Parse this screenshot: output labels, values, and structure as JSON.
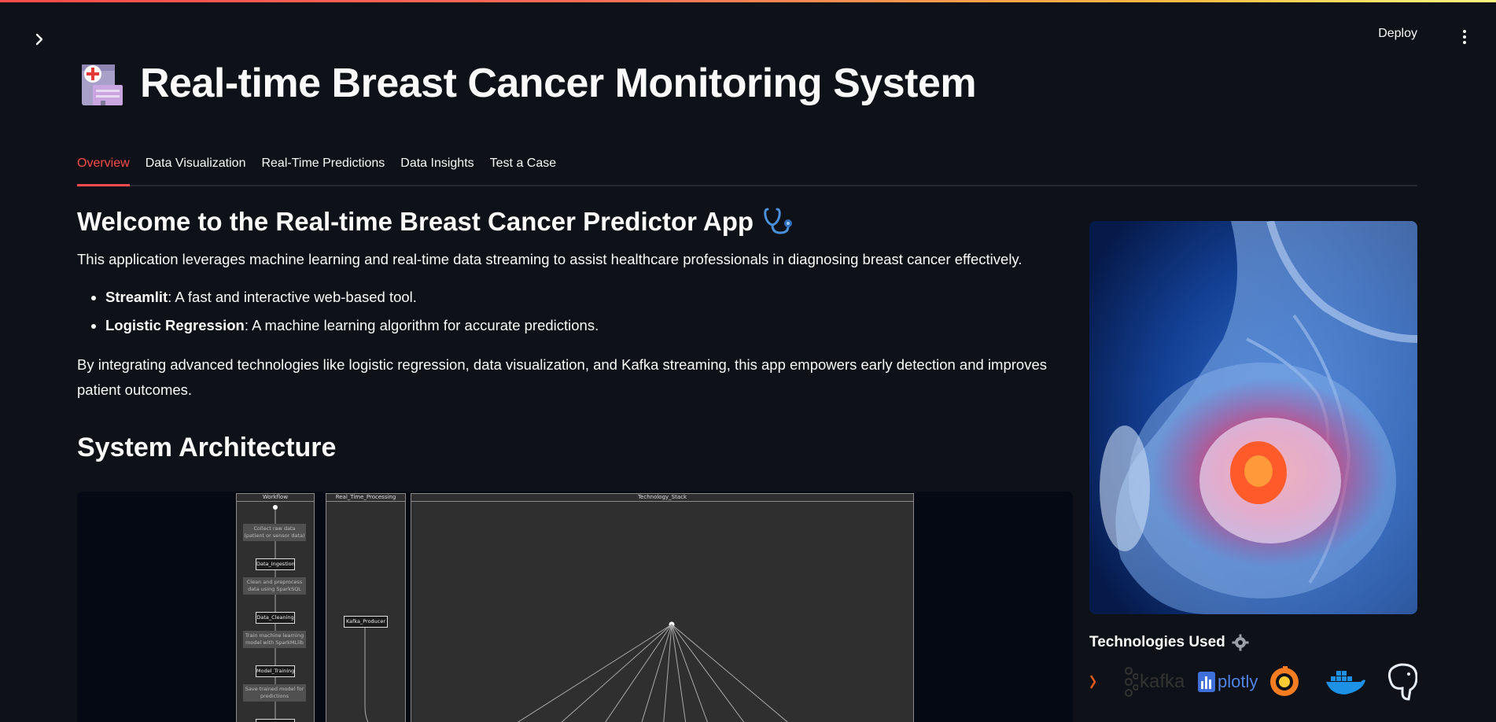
{
  "header": {
    "expand_icon": "chevron-right-icon",
    "deploy_label": "Deploy",
    "menu_icon": "kebab-menu-icon"
  },
  "page": {
    "title": "Real-time Breast Cancer Monitoring System",
    "title_icon": "hospital-icon"
  },
  "tabs": [
    {
      "label": "Overview",
      "active": true
    },
    {
      "label": "Data Visualization",
      "active": false
    },
    {
      "label": "Real-Time Predictions",
      "active": false
    },
    {
      "label": "Data Insights",
      "active": false
    },
    {
      "label": "Test a Case",
      "active": false
    }
  ],
  "overview": {
    "heading": "Welcome to the Real-time Breast Cancer Predictor App",
    "heading_icon": "stethoscope-icon",
    "intro": "This application leverages machine learning and real-time data streaming to assist healthcare professionals in diagnosing breast cancer effectively.",
    "bullets": [
      {
        "term": "Streamlit",
        "text": ": A fast and interactive web-based tool."
      },
      {
        "term": "Logistic Regression",
        "text": ": A machine learning algorithm for accurate predictions."
      }
    ],
    "outro": "By integrating advanced technologies like logistic regression, data visualization, and Kafka streaming, this app empowers early detection and improves patient outcomes.",
    "architecture_heading": "System Architecture"
  },
  "diagram": {
    "lanes": [
      "Workflow",
      "Real_Time_Processing",
      "Technology_Stack"
    ],
    "workflow_notes": [
      "Collect raw data (patient or sensor data)",
      "Clean and preprocess data using SparkSQL",
      "Train machine learning model with SparkMLlib",
      "Save trained model for predictions"
    ],
    "workflow_nodes": [
      "Data_Ingestion",
      "Data_Cleaning",
      "Model_Training"
    ],
    "realtime_nodes": [
      "Kafka_Producer"
    ]
  },
  "sidebar": {
    "tech_title": "Technologies Used",
    "tech_icon": "gear-icon",
    "logos": [
      "kafka",
      "plotly",
      "grafana-icon",
      "docker-icon",
      "postgresql-icon"
    ]
  },
  "colors": {
    "background": "#0e1117",
    "accent": "#ff4b4b",
    "text": "#fafafa"
  }
}
